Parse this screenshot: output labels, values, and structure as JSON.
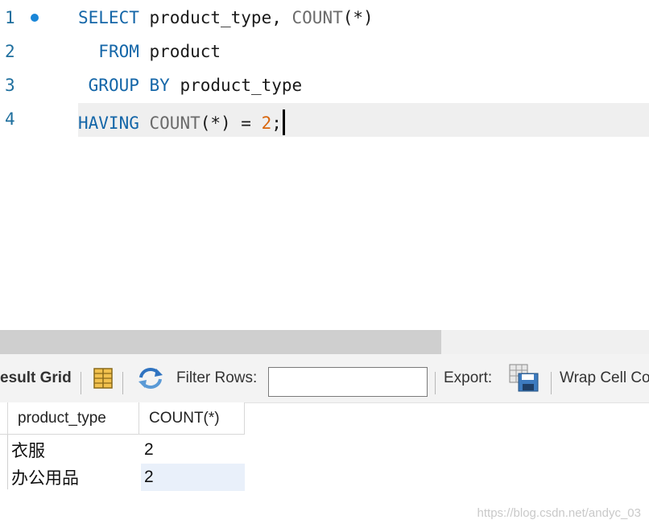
{
  "editor": {
    "lines": [
      {
        "num": "1",
        "indent": "",
        "tokens": [
          {
            "t": "SELECT",
            "c": "kw"
          },
          {
            "t": " product_type, ",
            "c": ""
          },
          {
            "t": "COUNT",
            "c": "fn"
          },
          {
            "t": "(*)",
            "c": ""
          }
        ]
      },
      {
        "num": "2",
        "indent": "  ",
        "tokens": [
          {
            "t": "FROM",
            "c": "kw"
          },
          {
            "t": " product",
            "c": ""
          }
        ]
      },
      {
        "num": "3",
        "indent": " ",
        "tokens": [
          {
            "t": "GROUP BY",
            "c": "kw"
          },
          {
            "t": " product_type",
            "c": ""
          }
        ]
      },
      {
        "num": "4",
        "indent": "",
        "tokens": [
          {
            "t": "HAVING",
            "c": "kw"
          },
          {
            "t": " ",
            "c": ""
          },
          {
            "t": "COUNT",
            "c": "fn"
          },
          {
            "t": "(*) = ",
            "c": ""
          },
          {
            "t": "2",
            "c": "num"
          },
          {
            "t": ";",
            "c": ""
          }
        ]
      }
    ]
  },
  "toolbar": {
    "result_grid_label": "esult Grid",
    "filter_rows_label": "Filter Rows:",
    "filter_value": "",
    "export_label": "Export:",
    "wrap_label": "Wrap Cell Co"
  },
  "grid": {
    "columns": [
      "product_type",
      "COUNT(*)"
    ],
    "rows": [
      [
        "衣服",
        "2"
      ],
      [
        "办公用品",
        "2"
      ]
    ]
  },
  "watermark": "https://blog.csdn.net/andyc_03",
  "colors": {
    "keyword": "#1466a8",
    "function": "#6b6b6b",
    "number": "#d9660d",
    "line_number": "#1f6f9e"
  }
}
